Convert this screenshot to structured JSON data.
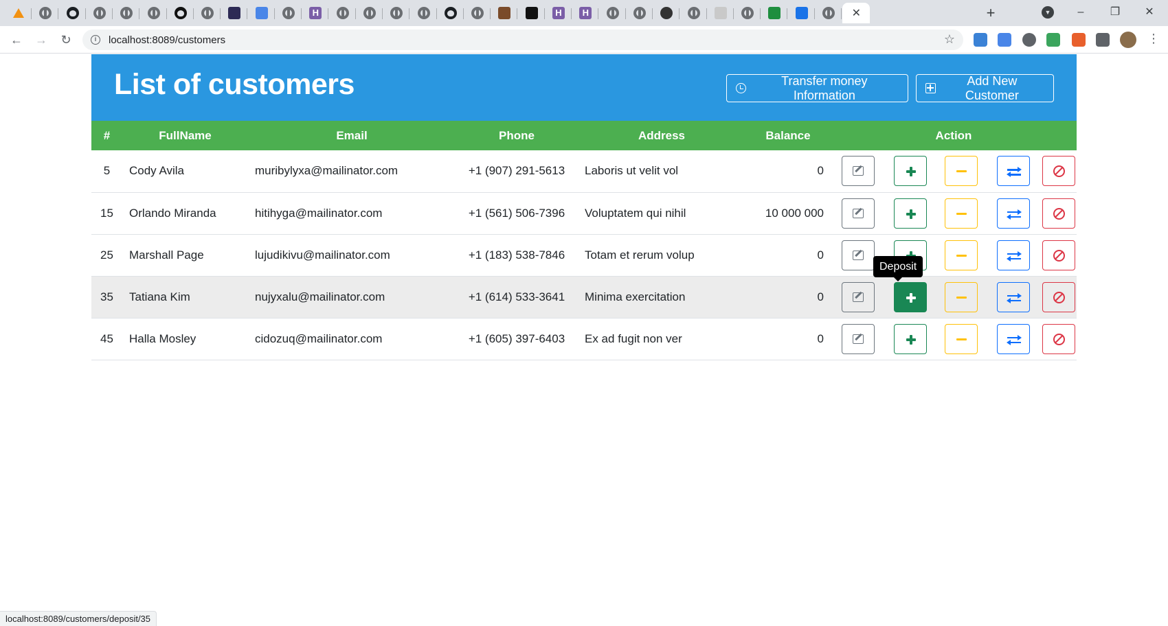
{
  "browser": {
    "tabs": [
      {
        "icon": "phpmyadmin-icon"
      },
      {
        "icon": "globe-icon"
      },
      {
        "icon": "github-icon"
      },
      {
        "icon": "globe-icon"
      },
      {
        "icon": "globe-icon"
      },
      {
        "icon": "globe-icon"
      },
      {
        "icon": "dark-circle-icon"
      },
      {
        "icon": "globe-icon"
      },
      {
        "icon": "terminal-icon"
      },
      {
        "icon": "translate-icon"
      },
      {
        "icon": "globe-icon"
      },
      {
        "icon": "hackmd-icon"
      },
      {
        "icon": "globe-icon"
      },
      {
        "icon": "globe-icon"
      },
      {
        "icon": "globe-icon"
      },
      {
        "icon": "globe-icon"
      },
      {
        "icon": "github-icon"
      },
      {
        "icon": "globe-icon"
      },
      {
        "icon": "person-icon"
      },
      {
        "icon": "intellij-icon"
      },
      {
        "icon": "hackmd-icon"
      },
      {
        "icon": "hackmd-icon"
      },
      {
        "icon": "globe-icon"
      },
      {
        "icon": "globe-icon"
      },
      {
        "icon": "eye-icon"
      },
      {
        "icon": "globe-icon"
      },
      {
        "icon": "pla-icon"
      },
      {
        "icon": "globe-icon"
      },
      {
        "icon": "classroom-icon"
      },
      {
        "icon": "contacts-icon"
      },
      {
        "icon": "globe-icon"
      }
    ],
    "new_tab_label": "+",
    "url": "localhost:8089/customers",
    "status_url": "localhost:8089/customers/deposit/35"
  },
  "page": {
    "title": "List of customers",
    "transfer_info_label": "Transfer money Information",
    "add_customer_label": "Add New Customer"
  },
  "table": {
    "columns": [
      "#",
      "FullName",
      "Email",
      "Phone",
      "Address",
      "Balance",
      "Action"
    ],
    "rows": [
      {
        "id": "5",
        "name": "Cody Avila",
        "email": "muribylyxa@mailinator.com",
        "phone": "+1 (907) 291-5613",
        "address": "Laboris ut velit vol",
        "balance": "0"
      },
      {
        "id": "15",
        "name": "Orlando Miranda",
        "email": "hitihyga@mailinator.com",
        "phone": "+1 (561) 506-7396",
        "address": "Voluptatem qui nihil",
        "balance": "10 000 000"
      },
      {
        "id": "25",
        "name": "Marshall Page",
        "email": "lujudikivu@mailinator.com",
        "phone": "+1 (183) 538-7846",
        "address": "Totam et rerum volup",
        "balance": "0"
      },
      {
        "id": "35",
        "name": "Tatiana Kim",
        "email": "nujyxalu@mailinator.com",
        "phone": "+1 (614) 533-3641",
        "address": "Minima exercitation",
        "balance": "0"
      },
      {
        "id": "45",
        "name": "Halla Mosley",
        "email": "cidozuq@mailinator.com",
        "phone": "+1 (605) 397-6403",
        "address": "Ex ad fugit non ver",
        "balance": "0"
      }
    ]
  },
  "tooltip": {
    "text": "Deposit"
  },
  "colors": {
    "header_bg": "#2a97e0",
    "table_header_bg": "#4caf50",
    "edit": "#6c757d",
    "deposit": "#198754",
    "withdraw": "#ffc107",
    "transfer": "#0d6efd",
    "suspend": "#dc3545"
  }
}
